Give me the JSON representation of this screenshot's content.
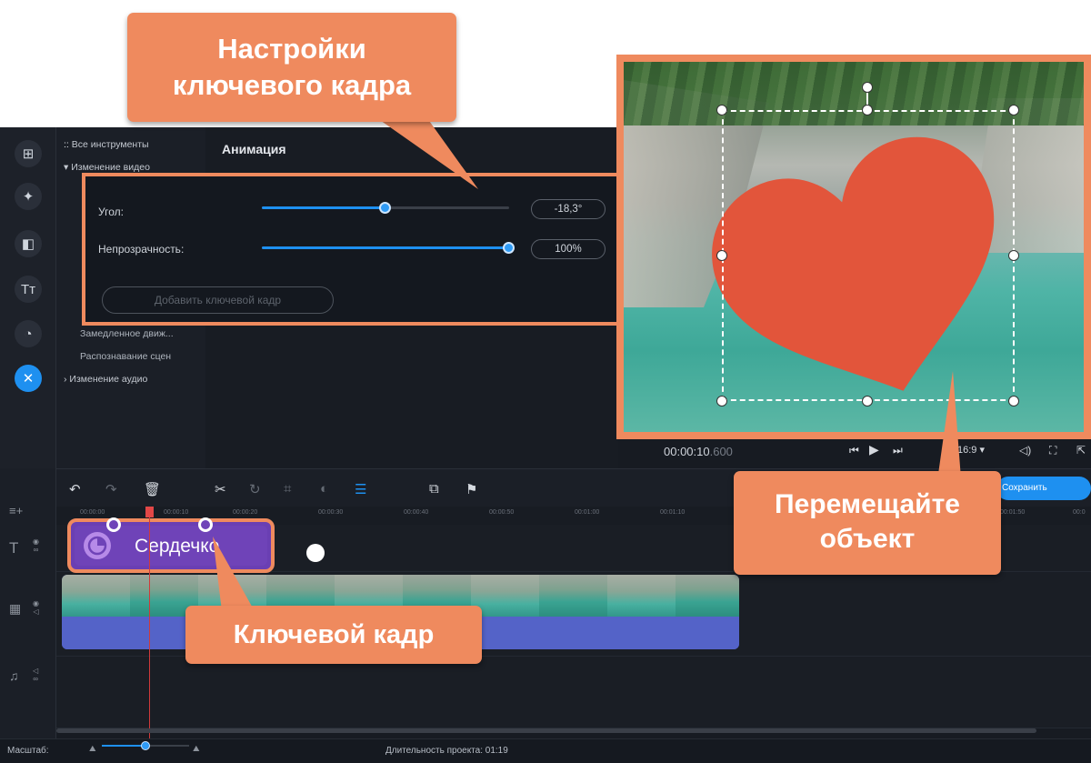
{
  "callouts": {
    "keyframe_settings": [
      "Настройки",
      "ключевого кадра"
    ],
    "move_object": [
      "Перемещайте",
      "объект"
    ],
    "keyframe": "Ключевой кадр"
  },
  "sidebar": {
    "items": [
      {
        "label": "Все инструменты",
        "prefix": "::"
      },
      {
        "label": "Изменение видео",
        "prefix": "▾"
      },
      {
        "label": "Замедленное движ..."
      },
      {
        "label": "Распознавание сцен"
      },
      {
        "label": "Изменение аудио",
        "prefix": "›"
      }
    ]
  },
  "panel": {
    "title": "Анимация",
    "angle_label": "Угол:",
    "angle_value": "-18,3°",
    "angle_level": 0.5,
    "opacity_label": "Непрозрачность:",
    "opacity_value": "100%",
    "opacity_level": 1.0,
    "add_keyframe": "Добавить ключевой кадр"
  },
  "player": {
    "time": "00:00:10",
    "time_ms": ".600",
    "aspect": "16:9 ▾",
    "save": "Сохранить"
  },
  "timeline": {
    "ruler_labels": [
      "00:00:00",
      "00:00:10",
      "00:00:20",
      "00:00:30",
      "00:00:40",
      "00:00:50",
      "00:01:00",
      "00:01:10",
      "00:01:50",
      "00:0"
    ],
    "title_clip": "Сердечко"
  },
  "status": {
    "zoom_label": "Масштаб:",
    "duration": "Длительность проекта: 01:19"
  },
  "colors": {
    "accent": "#1e90f0",
    "callout": "#ef8a5e",
    "heart": "#e2553b",
    "title_clip": "#6f43b8",
    "video_clip": "#5461c6"
  }
}
